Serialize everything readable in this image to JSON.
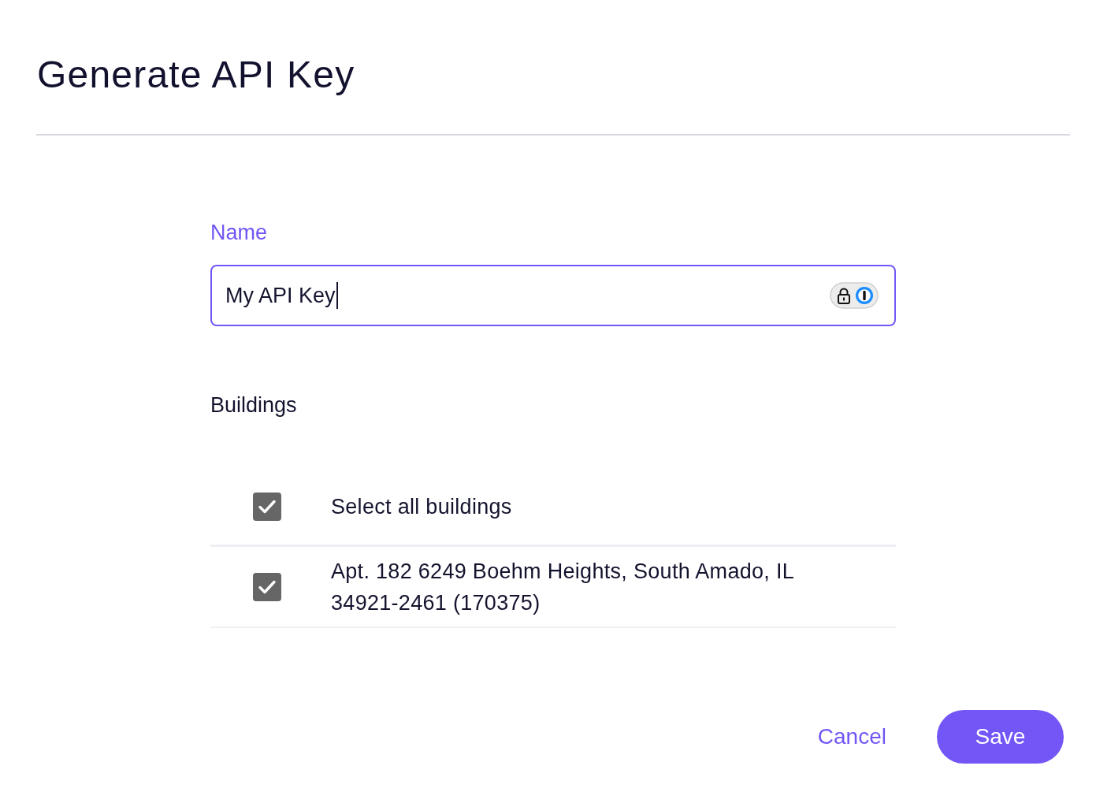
{
  "title": "Generate API Key",
  "name_field": {
    "label": "Name",
    "value": "My API Key",
    "focused": true
  },
  "buildings": {
    "heading": "Buildings",
    "select_all": {
      "label": "Select all buildings",
      "checked": true
    },
    "items": [
      {
        "label": "Apt. 182 6249 Boehm Heights, South Amado, IL 34921-2461 (170375)",
        "checked": true
      }
    ]
  },
  "buttons": [
    {
      "label": "Cancel",
      "kind": "text"
    },
    {
      "label": "Save",
      "kind": "primary"
    }
  ]
}
